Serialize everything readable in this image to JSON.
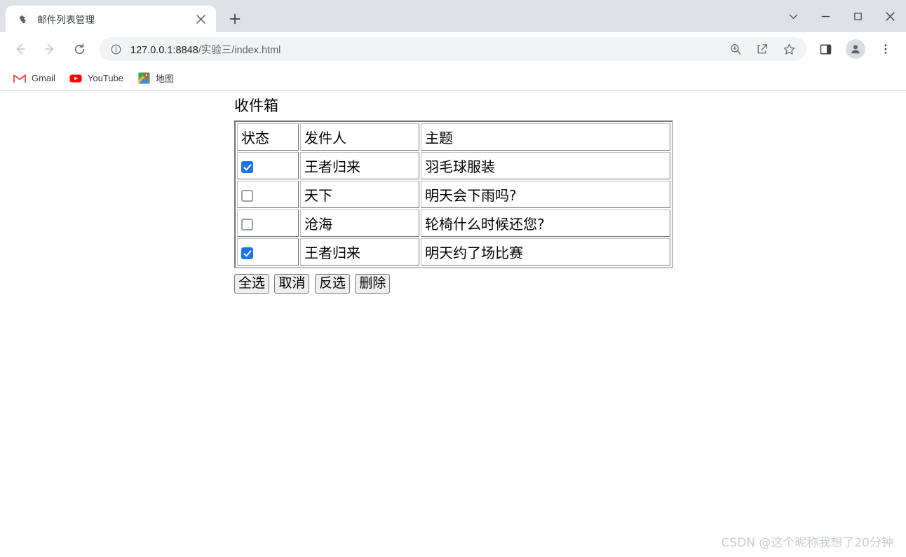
{
  "window": {
    "controls": [
      {
        "name": "tab-search-button",
        "glyph": "chevron-down"
      },
      {
        "name": "minimize-button",
        "glyph": "minimize"
      },
      {
        "name": "maximize-button",
        "glyph": "maximize"
      },
      {
        "name": "close-button",
        "glyph": "close"
      }
    ]
  },
  "tab": {
    "title": "邮件列表管理",
    "favicon": "globe-icon",
    "close_label": "×",
    "newtab_label": "+"
  },
  "toolbar": {
    "back_label": "←",
    "forward_label": "→",
    "reload_label": "⟳",
    "url_host": "127.0.0.1:8848",
    "url_path": "/实验三/index.html",
    "url_full": "127.0.0.1:8848/实验三/index.html",
    "site_info_icon": "info-circle-icon",
    "zoom_icon": "zoom-in-icon",
    "share_icon": "share-icon",
    "bookmark_icon": "star-icon",
    "sidepanel_icon": "side-panel-icon",
    "profile_icon": "person-icon",
    "menu_icon": "three-dot-menu-icon"
  },
  "bookmarks": [
    {
      "label": "Gmail",
      "icon": "gmail-icon"
    },
    {
      "label": "YouTube",
      "icon": "youtube-icon"
    },
    {
      "label": "地图",
      "icon": "google-maps-icon"
    }
  ],
  "page": {
    "heading": "收件箱",
    "table": {
      "headers": [
        "状态",
        "发件人",
        "主题"
      ],
      "rows": [
        {
          "checked": true,
          "sender": "王者归来",
          "subject": "羽毛球服装"
        },
        {
          "checked": false,
          "sender": "天下",
          "subject": "明天会下雨吗?"
        },
        {
          "checked": false,
          "sender": "沧海",
          "subject": "轮椅什么时候还您?"
        },
        {
          "checked": true,
          "sender": "王者归来",
          "subject": "明天约了场比赛"
        }
      ]
    },
    "buttons": [
      {
        "name": "select-all-button",
        "label": "全选"
      },
      {
        "name": "cancel-button",
        "label": "取消"
      },
      {
        "name": "invert-selection-button",
        "label": "反选"
      },
      {
        "name": "delete-button",
        "label": "删除"
      }
    ],
    "watermark": "CSDN @这个昵称我想了20分钟"
  },
  "colors": {
    "tabstrip_bg": "#dee1e6",
    "omnibox_bg": "#f1f3f4",
    "checkbox_checked": "#1a73e8",
    "watermark": "#c9ccd1"
  }
}
